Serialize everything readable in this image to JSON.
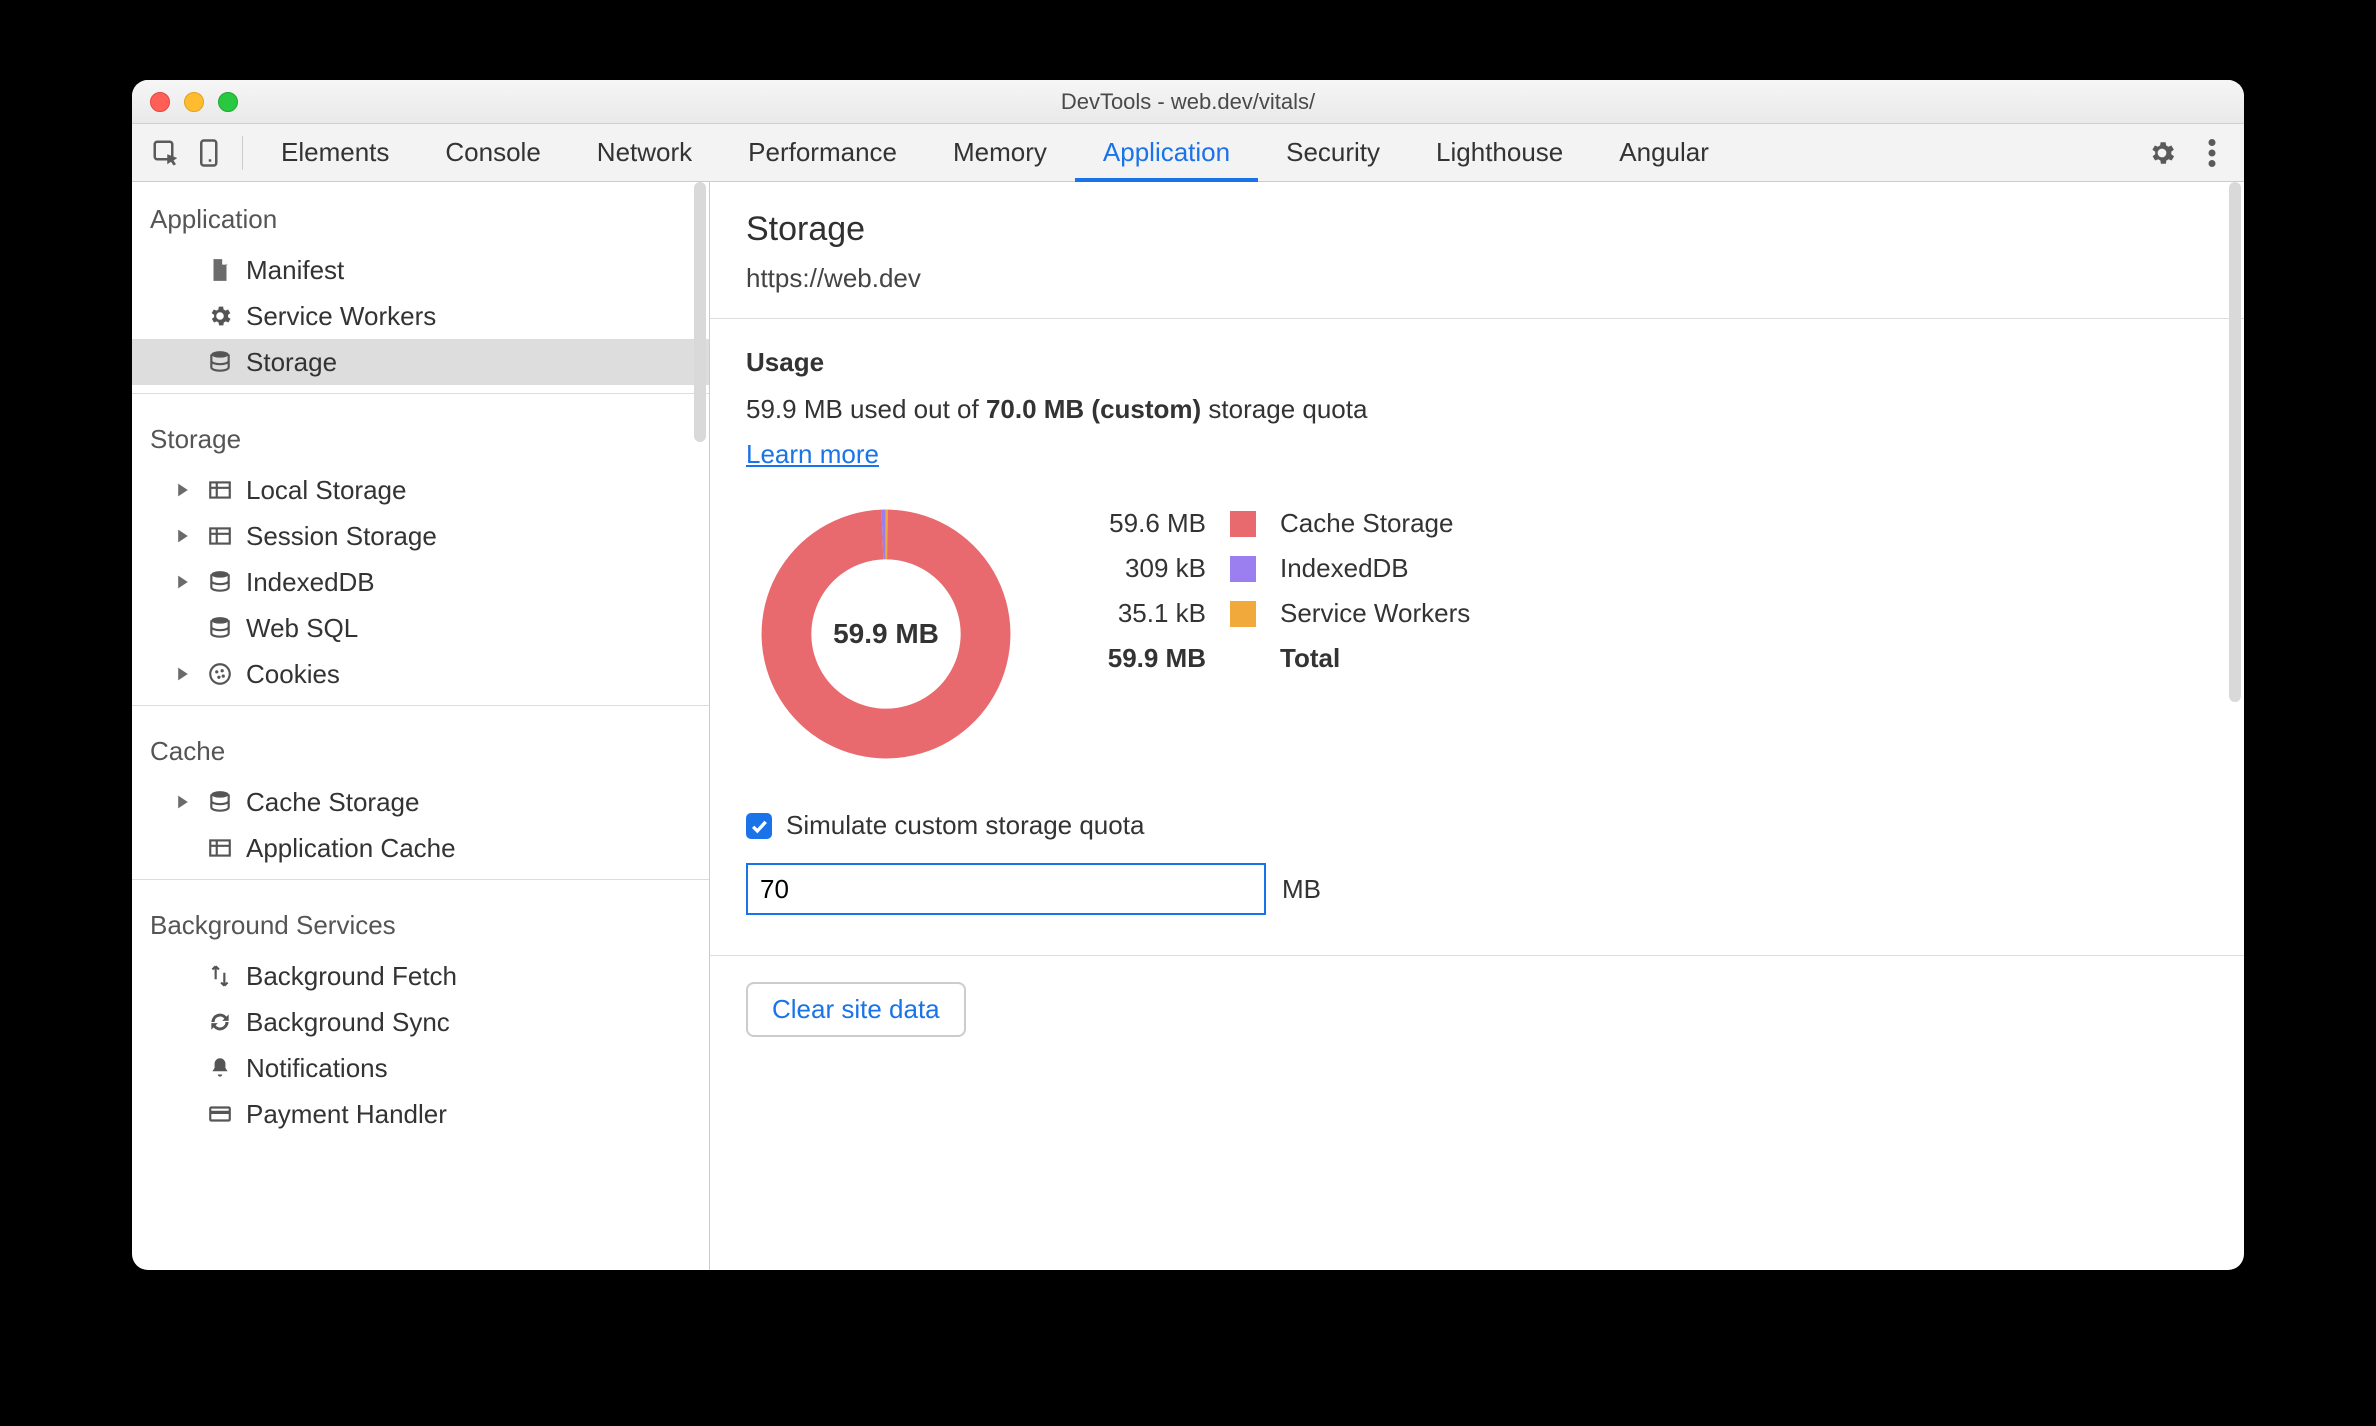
{
  "window": {
    "title": "DevTools - web.dev/vitals/"
  },
  "tabs": {
    "items": [
      "Elements",
      "Console",
      "Network",
      "Performance",
      "Memory",
      "Application",
      "Security",
      "Lighthouse",
      "Angular"
    ],
    "active": "Application"
  },
  "sidebar": {
    "groups": [
      {
        "title": "Application",
        "items": [
          {
            "label": "Manifest",
            "icon": "file-icon",
            "caret": false
          },
          {
            "label": "Service Workers",
            "icon": "gear-icon",
            "caret": false
          },
          {
            "label": "Storage",
            "icon": "database-icon",
            "caret": false,
            "selected": true
          }
        ]
      },
      {
        "title": "Storage",
        "items": [
          {
            "label": "Local Storage",
            "icon": "grid-icon",
            "caret": true
          },
          {
            "label": "Session Storage",
            "icon": "grid-icon",
            "caret": true
          },
          {
            "label": "IndexedDB",
            "icon": "database-icon",
            "caret": true
          },
          {
            "label": "Web SQL",
            "icon": "database-icon",
            "caret": false
          },
          {
            "label": "Cookies",
            "icon": "cookie-icon",
            "caret": true
          }
        ]
      },
      {
        "title": "Cache",
        "items": [
          {
            "label": "Cache Storage",
            "icon": "database-icon",
            "caret": true
          },
          {
            "label": "Application Cache",
            "icon": "grid-icon",
            "caret": false
          }
        ]
      },
      {
        "title": "Background Services",
        "items": [
          {
            "label": "Background Fetch",
            "icon": "updown-icon",
            "caret": false
          },
          {
            "label": "Background Sync",
            "icon": "sync-icon",
            "caret": false
          },
          {
            "label": "Notifications",
            "icon": "bell-icon",
            "caret": false
          },
          {
            "label": "Payment Handler",
            "icon": "card-icon",
            "caret": false
          }
        ]
      }
    ]
  },
  "main": {
    "title": "Storage",
    "origin": "https://web.dev",
    "usage": {
      "heading": "Usage",
      "used_text": "59.9 MB used out of ",
      "quota_bold": "70.0 MB (custom)",
      "quota_suffix": " storage quota",
      "learn_more": "Learn more",
      "center_label": "59.9 MB",
      "legend": [
        {
          "size": "59.6 MB",
          "name": "Cache Storage",
          "color": "#e96a6e"
        },
        {
          "size": "309 kB",
          "name": "IndexedDB",
          "color": "#9b7ff1"
        },
        {
          "size": "35.1 kB",
          "name": "Service Workers",
          "color": "#f2a93b"
        }
      ],
      "total_size": "59.9 MB",
      "total_label": "Total",
      "simulate_label": "Simulate custom storage quota",
      "simulate_checked": true,
      "quota_value": "70",
      "quota_unit": "MB"
    },
    "clear_label": "Clear site data"
  },
  "chart_data": {
    "type": "pie",
    "title": "Storage usage",
    "unit": "bytes",
    "series": [
      {
        "name": "Cache Storage",
        "value": 59600000,
        "display": "59.6 MB",
        "color": "#e96a6e"
      },
      {
        "name": "IndexedDB",
        "value": 309000,
        "display": "309 kB",
        "color": "#9b7ff1"
      },
      {
        "name": "Service Workers",
        "value": 35100,
        "display": "35.1 kB",
        "color": "#f2a93b"
      }
    ],
    "total": {
      "value": 59900000,
      "display": "59.9 MB"
    },
    "quota": {
      "value": 70000000,
      "display": "70.0 MB",
      "custom": true
    }
  }
}
